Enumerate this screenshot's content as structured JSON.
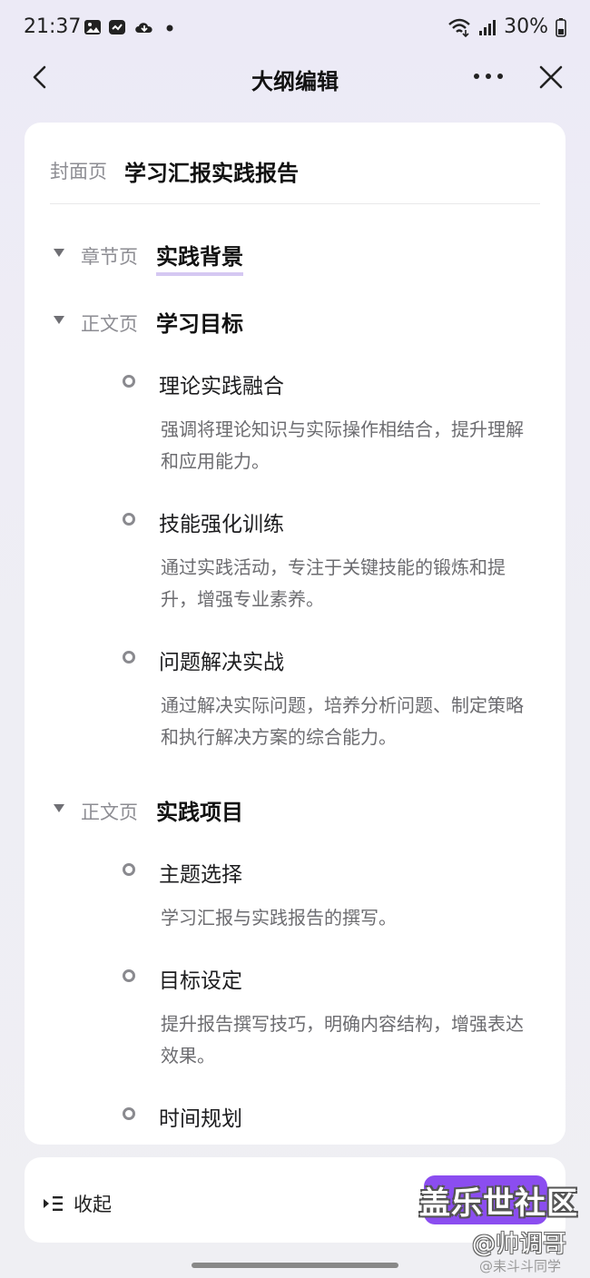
{
  "status_bar": {
    "time": "21:37",
    "left_icons": [
      "image-icon",
      "sync-icon",
      "cloud-icon",
      "dot-icon"
    ],
    "battery": "30%"
  },
  "header": {
    "title": "大纲编辑"
  },
  "outline": {
    "cover": {
      "type": "封面页",
      "title": "学习汇报实践报告"
    },
    "sections": [
      {
        "type": "章节页",
        "title": "实践背景",
        "items": []
      },
      {
        "type": "正文页",
        "title": "学习目标",
        "items": [
          {
            "title": "理论实践融合",
            "desc": "强调将理论知识与实际操作相结合，提升理解和应用能力。"
          },
          {
            "title": "技能强化训练",
            "desc": "通过实践活动，专注于关键技能的锻炼和提升，增强专业素养。"
          },
          {
            "title": "问题解决实战",
            "desc": "通过解决实际问题，培养分析问题、制定策略和执行解决方案的综合能力。"
          }
        ]
      },
      {
        "type": "正文页",
        "title": "实践项目",
        "items": [
          {
            "title": "主题选择",
            "desc": "学习汇报与实践报告的撰写。"
          },
          {
            "title": "目标设定",
            "desc": "提升报告撰写技巧，明确内容结构，增强表达效果。"
          },
          {
            "title": "时间规划",
            "desc": ""
          }
        ]
      }
    ]
  },
  "bottom_bar": {
    "collapse_label": "收起",
    "accent_color": "#8b4df0"
  },
  "watermarks": {
    "line1": "盖乐世社区",
    "line2": "@帅调哥",
    "line3": "@耒斗斗同学"
  }
}
